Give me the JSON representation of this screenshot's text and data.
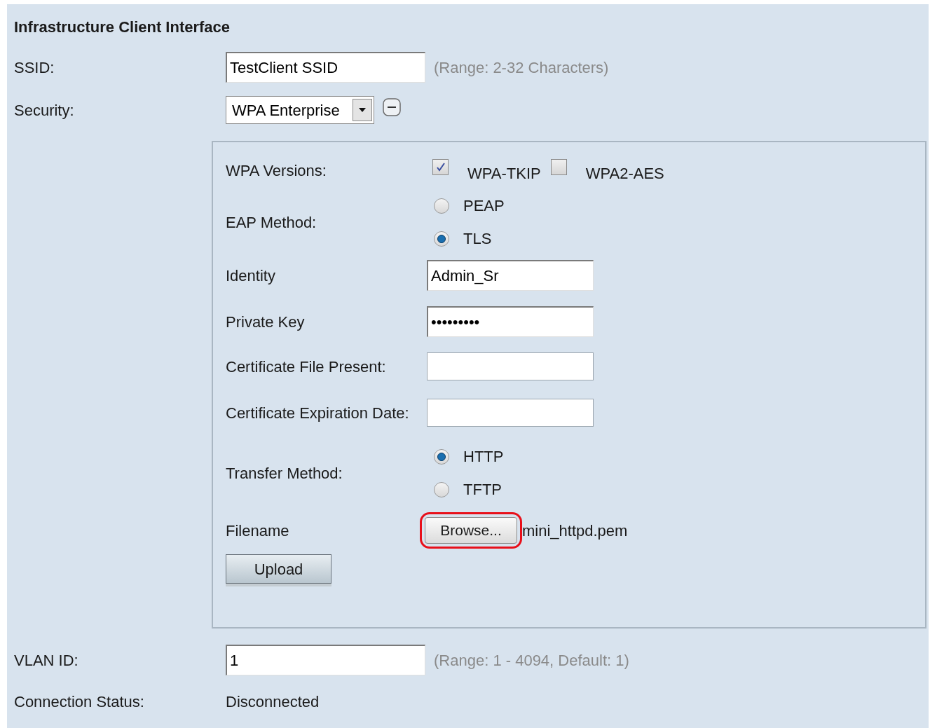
{
  "title": "Infrastructure Client Interface",
  "ssid": {
    "label": "SSID:",
    "value": "TestClient SSID",
    "hint": "(Range: 2-32 Characters)"
  },
  "security": {
    "label": "Security:",
    "value": "WPA Enterprise",
    "expanded": true
  },
  "wpa_versions": {
    "label": "WPA Versions:",
    "options": [
      {
        "label": "WPA-TKIP",
        "checked": true
      },
      {
        "label": "WPA2-AES",
        "checked": false
      }
    ]
  },
  "eap_method": {
    "label": "EAP Method:",
    "options": [
      {
        "label": "PEAP",
        "selected": false
      },
      {
        "label": "TLS",
        "selected": true
      }
    ]
  },
  "identity": {
    "label": "Identity",
    "value": "Admin_Sr"
  },
  "private_key": {
    "label": "Private Key",
    "value": "•••••••••"
  },
  "certificate_file_present": {
    "label": "Certificate File Present:"
  },
  "certificate_expiration_date": {
    "label": "Certificate Expiration Date:"
  },
  "transfer_method": {
    "label": "Transfer Method:",
    "options": [
      {
        "label": "HTTP",
        "selected": true
      },
      {
        "label": "TFTP",
        "selected": false
      }
    ]
  },
  "filename": {
    "label": "Filename",
    "button": "Browse...",
    "highlighted": true,
    "value": "mini_httpd.pem"
  },
  "upload_button": "Upload",
  "vlan_id": {
    "label": "VLAN ID:",
    "value": "1",
    "hint": "(Range: 1 - 4094, Default: 1)"
  },
  "connection_status": {
    "label": "Connection Status:",
    "value": "Disconnected"
  }
}
